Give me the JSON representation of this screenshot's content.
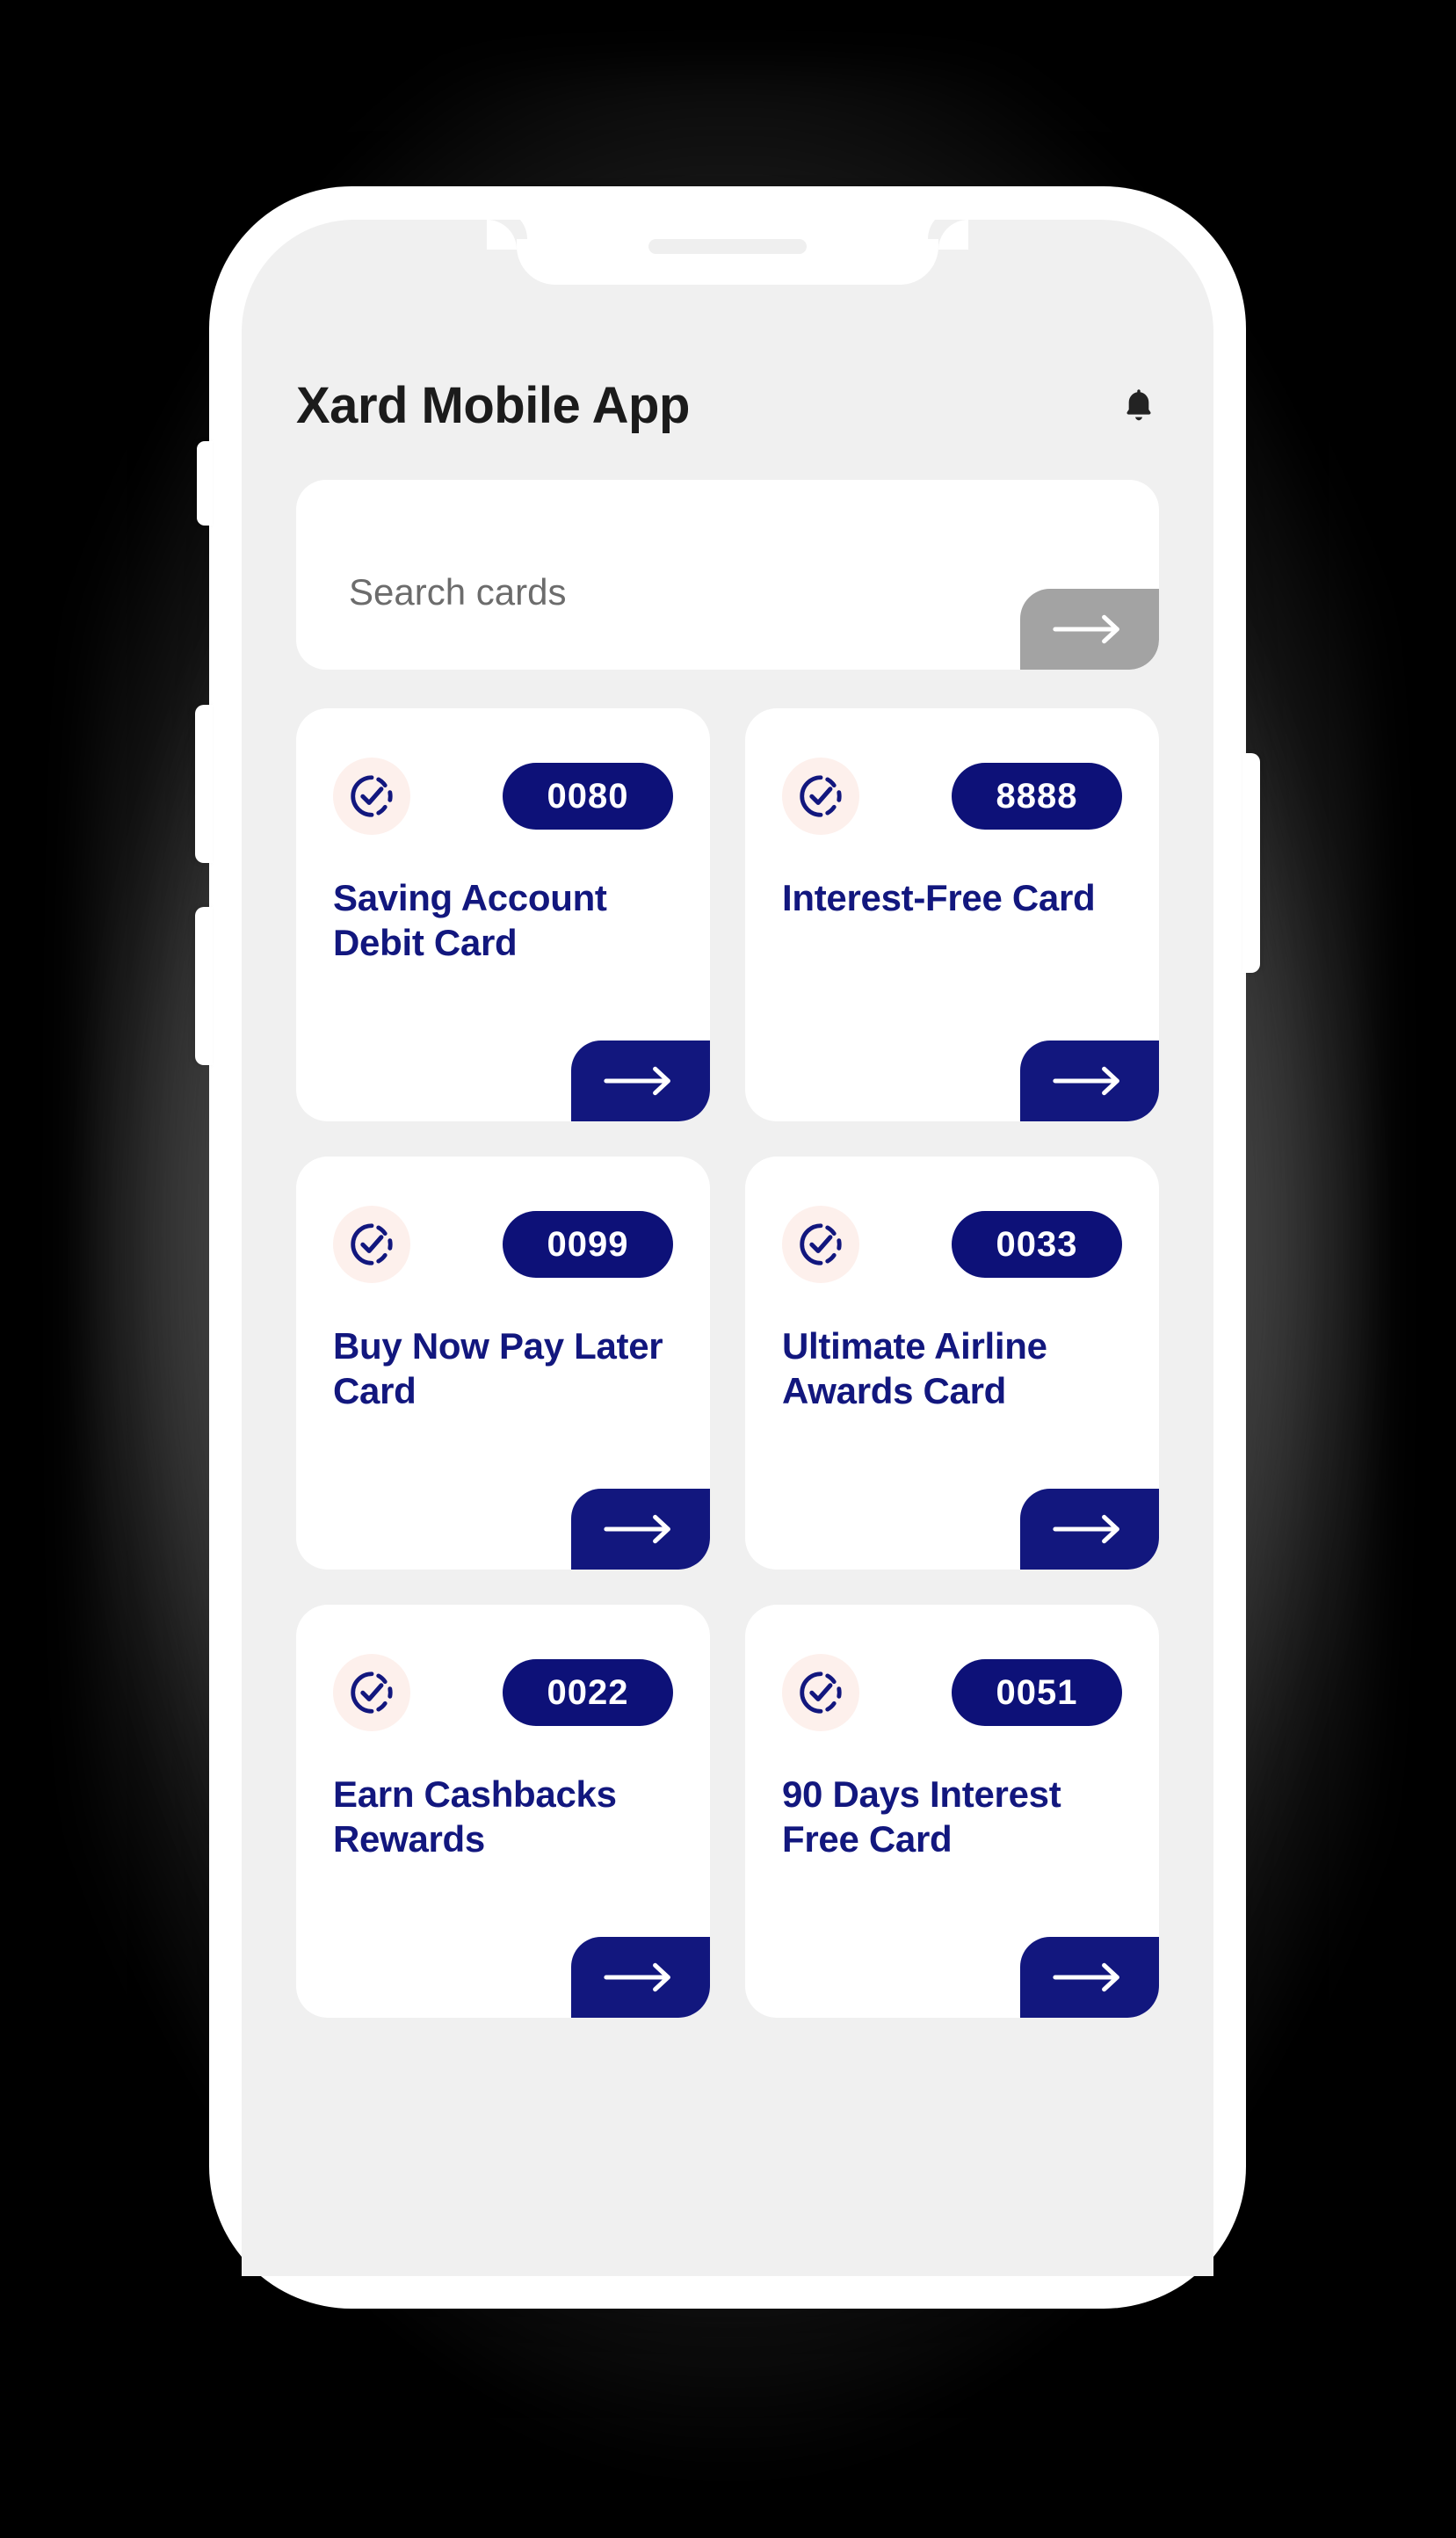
{
  "colors": {
    "navy": "#12177e",
    "pill_navy": "#0d1178",
    "icon_bg_pink": "#fdf0ec",
    "screen_bg": "#f0f0f0",
    "search_button_gray": "#a3a3a3",
    "page_bg": "#000000",
    "card_bg": "#ffffff"
  },
  "device": {
    "frame": "phone-mockup",
    "speaker_name": "earpiece-speaker",
    "buttons": [
      "silence-switch",
      "volume-up",
      "volume-down",
      "power"
    ]
  },
  "header": {
    "title": "Xard Mobile App",
    "notification_icon": "bell-icon"
  },
  "search": {
    "placeholder": "Search cards",
    "value": "",
    "submit_icon": "arrow-right-icon"
  },
  "cards": [
    {
      "number": "0080",
      "title": "Saving Account Debit Card",
      "status_icon": "check-circle-dashed-icon",
      "action_icon": "arrow-right-icon"
    },
    {
      "number": "8888",
      "title": "Interest-Free Card",
      "status_icon": "check-circle-dashed-icon",
      "action_icon": "arrow-right-icon"
    },
    {
      "number": "0099",
      "title": "Buy Now Pay Later Card",
      "status_icon": "check-circle-dashed-icon",
      "action_icon": "arrow-right-icon"
    },
    {
      "number": "0033",
      "title": "Ultimate Airline Awards Card",
      "status_icon": "check-circle-dashed-icon",
      "action_icon": "arrow-right-icon"
    },
    {
      "number": "0022",
      "title": "Earn Cashbacks Rewards",
      "status_icon": "check-circle-dashed-icon",
      "action_icon": "arrow-right-icon"
    },
    {
      "number": "0051",
      "title": "90 Days Interest Free Card",
      "status_icon": "check-circle-dashed-icon",
      "action_icon": "arrow-right-icon"
    }
  ]
}
